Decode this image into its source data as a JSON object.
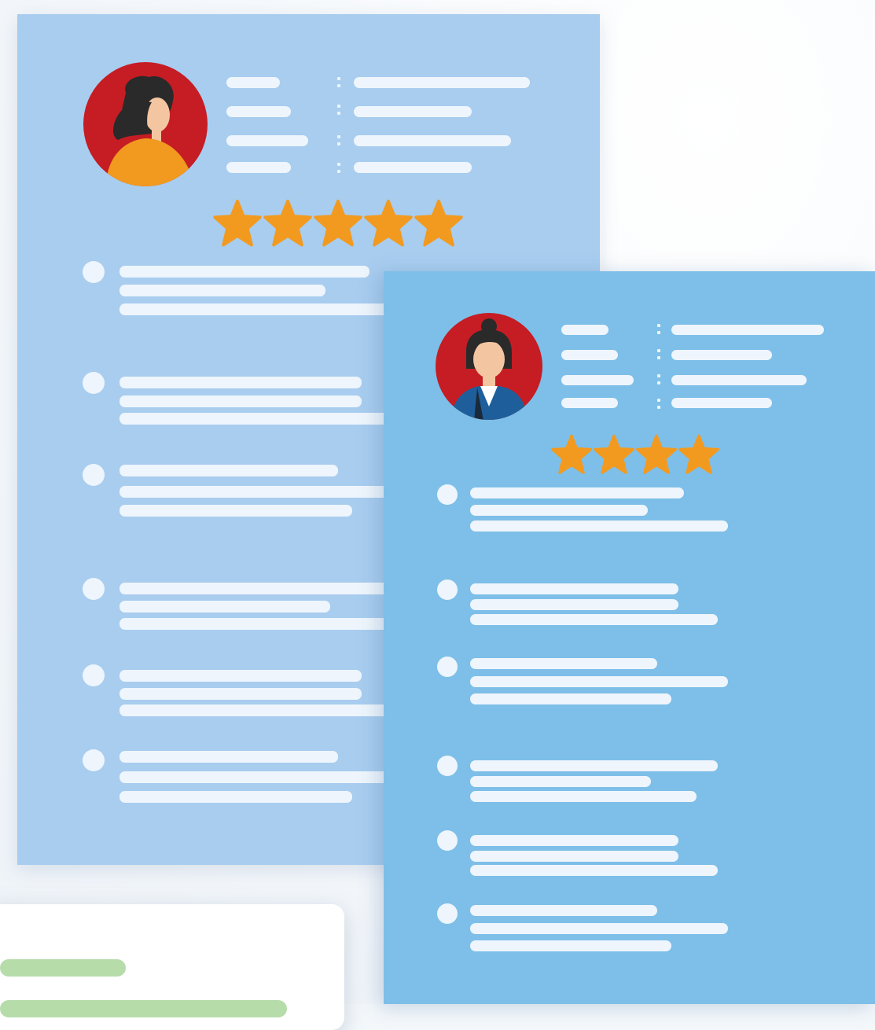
{
  "colors": {
    "back_sheet": "#a8cdef",
    "front_sheet": "#7dbfe8",
    "placeholder_line": "#eef5fc",
    "star": "#f29a1f",
    "avatar_bg": "#c51d23",
    "card": "#ffffff",
    "green_line": "#b6dcaa"
  },
  "icons": {
    "avatar_back": "woman-avatar-icon",
    "avatar_front": "woman-bun-avatar-icon",
    "star": "star-icon"
  },
  "profiles": [
    {
      "name": "back-profile",
      "rating": 5,
      "rating_max": 5
    },
    {
      "name": "front-profile",
      "rating": 4,
      "rating_max": 4
    }
  ]
}
